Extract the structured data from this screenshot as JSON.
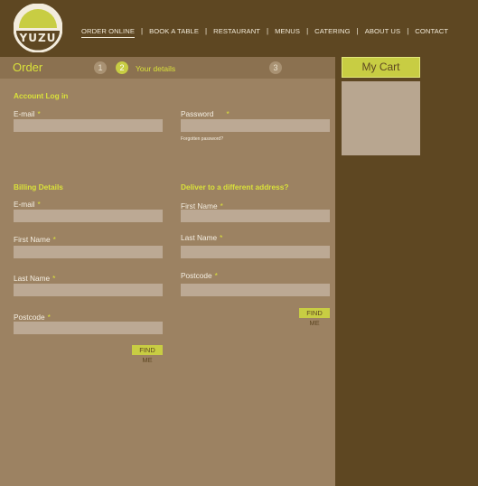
{
  "logo": {
    "text": "YUZU"
  },
  "nav": {
    "items": [
      "ORDER ONLINE",
      "BOOK A TABLE",
      "RESTAURANT",
      "MENUS",
      "CATERING",
      "ABOUT US",
      "CONTACT"
    ],
    "separator": "|"
  },
  "order": {
    "title": "Order",
    "steps": [
      {
        "number": "1",
        "label": ""
      },
      {
        "number": "2",
        "label": "Your details"
      },
      {
        "number": "3",
        "label": ""
      }
    ]
  },
  "account_login": {
    "title": "Account Log in",
    "email_label": "E-mail",
    "password_label": "Password",
    "forgot_link": "Forgotten password?"
  },
  "billing": {
    "title": "Billing Details",
    "email_label": "E-mail",
    "first_name_label": "First Name",
    "last_name_label": "Last Name",
    "postcode_label": "Postcode",
    "find_button": "FIND ME"
  },
  "delivery": {
    "title": "Deliver to a different address?",
    "first_name_label": "First Name",
    "last_name_label": "Last Name",
    "postcode_label": "Postcode",
    "find_button": "FIND ME"
  },
  "required_marker": "*",
  "cart": {
    "title": "My Cart"
  },
  "colors": {
    "background": "#5e4722",
    "panel": "#9c8262",
    "accent": "#c8cd43",
    "input": "#bca994"
  }
}
